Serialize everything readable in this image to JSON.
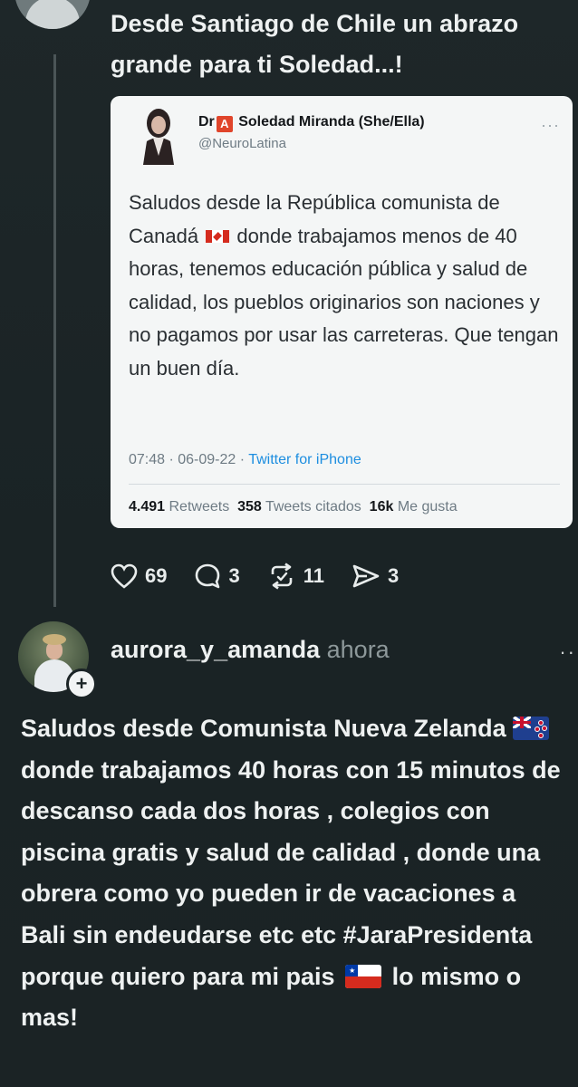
{
  "first_post": {
    "text": "Desde Santiago de Chile un abrazo grande para ti Soledad...!",
    "quoted_tweet": {
      "name_prefix": "Dr",
      "badge": "A",
      "name": "Soledad Miranda (She/Ella)",
      "handle": "@NeuroLatina",
      "more": "···",
      "body_part1": "Saludos desde la República comunista de Canadá",
      "body_part2": "donde trabajamos menos de 40 horas, tenemos educación pública y salud de calidad, los pueblos originarios son naciones y no pagamos por usar las carreteras. Que tengan un buen día.",
      "timestamp": "07:48 · 06-09-22 · ",
      "via": "Twitter for iPhone",
      "retweets_count": "4.491",
      "retweets_label": "Retweets",
      "quotes_count": "358",
      "quotes_label": "Tweets citados",
      "likes_count": "16k",
      "likes_label": "Me gusta"
    },
    "actions": {
      "likes": "69",
      "replies": "3",
      "reposts": "11",
      "shares": "3"
    }
  },
  "second_post": {
    "username": "aurora_y_amanda",
    "time": "ahora",
    "more": "··",
    "follow_badge": "+",
    "text_part1": "Saludos desde Comunista Nueva Zelanda",
    "text_part2": "donde trabajamos 40 horas con 15 minutos de descanso cada dos horas , colegios con piscina gratis y salud de calidad , donde una obrera como yo pueden ir de vacaciones a Bali sin endeudarse etc etc #JaraPresidenta porque quiero para mi pais",
    "text_part3": "lo mismo o mas!"
  },
  "colors": {
    "background": "#1b2426",
    "card": "#f4f6f6",
    "link": "#1d8ee0",
    "muted": "#8d989a"
  }
}
